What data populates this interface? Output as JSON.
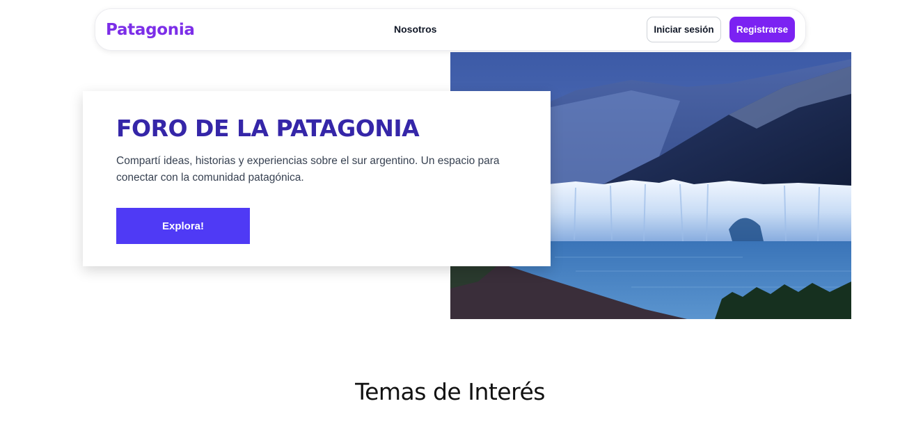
{
  "nav": {
    "brand": "Patagonia",
    "links": [
      {
        "label": "Nosotros"
      }
    ],
    "login_label": "Iniciar sesión",
    "register_label": "Registrarse"
  },
  "hero": {
    "title": "FORO DE LA PATAGONIA",
    "description": "Compartí ideas, historias y experiencias sobre el sur argentino. Un espacio para conectar con la comunidad patagónica.",
    "cta_label": "Explora!",
    "image_subject": "glacier-lake-mountains"
  },
  "section": {
    "title": "Temas de Interés"
  },
  "colors": {
    "brand": "#7c2ee8",
    "register_button": "#7b22f2",
    "hero_title": "#3526a8",
    "cta_button": "#4f3af5"
  }
}
